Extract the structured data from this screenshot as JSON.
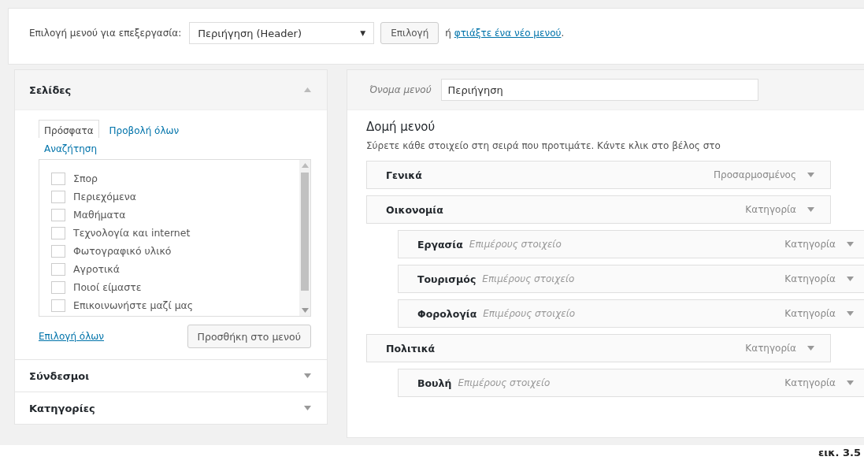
{
  "menu_select_bar": {
    "label": "Επιλογή μενού για επεξεργασία:",
    "dropdown": {
      "value": "Περιήγηση (Header)",
      "arrow": "▼"
    },
    "select_button": "Επιλογή",
    "or_text": "ή",
    "create_link": "φτιάξτε ένα νέο μενού",
    "period": "."
  },
  "sidebar": {
    "sections": [
      {
        "title": "Σελίδες",
        "expanded": true,
        "tabs": [
          {
            "label": "Πρόσφατα",
            "selected": true
          },
          {
            "label": "Προβολή όλων",
            "selected": false
          },
          {
            "label": "Αναζήτηση",
            "selected": false
          }
        ],
        "pages": [
          {
            "label": "Σπορ",
            "checked": false
          },
          {
            "label": "Περιεχόμενα",
            "checked": false
          },
          {
            "label": "Μαθήματα",
            "checked": false
          },
          {
            "label": "Τεχνολογία και internet",
            "checked": false
          },
          {
            "label": "Φωτογραφικό υλικό",
            "checked": false
          },
          {
            "label": "Αγροτικά",
            "checked": false
          },
          {
            "label": "Ποιοί είμαστε",
            "checked": false
          },
          {
            "label": "Επικοινωνήστε μαζί μας",
            "checked": false
          }
        ],
        "select_all": "Επιλογή όλων",
        "add_button": "Προσθήκη στο μενού"
      },
      {
        "title": "Σύνδεσμοι",
        "expanded": false
      },
      {
        "title": "Κατηγορίες",
        "expanded": false
      }
    ]
  },
  "menu_editor": {
    "name_label": "Όνομα μενού",
    "name_value": "Περιήγηση",
    "structure_title": "Δομή μενού",
    "instructions": "Σύρετε κάθε στοιχείο στη σειρά που προτιμάτε. Κάντε κλικ στο βέλος στο",
    "items": [
      {
        "title": "Γενικά",
        "type": "Προσαρμοσμένος"
      },
      {
        "title": "Οικονομία",
        "type": "Κατηγορία",
        "children": [
          {
            "title": "Εργασία",
            "subtitle": "Επιμέρους στοιχείο",
            "type": "Κατηγορία"
          },
          {
            "title": "Τουρισμός",
            "subtitle": "Επιμέρους στοιχείο",
            "type": "Κατηγορία"
          },
          {
            "title": "Φορολογία",
            "subtitle": "Επιμέρους στοιχείο",
            "type": "Κατηγορία"
          }
        ]
      },
      {
        "title": "Πολιτικά",
        "type": "Κατηγορία",
        "children": [
          {
            "title": "Βουλή",
            "subtitle": "Επιμέρους στοιχείο",
            "type": "Κατηγορία"
          }
        ]
      }
    ]
  },
  "caption": "εικ. 3.5"
}
